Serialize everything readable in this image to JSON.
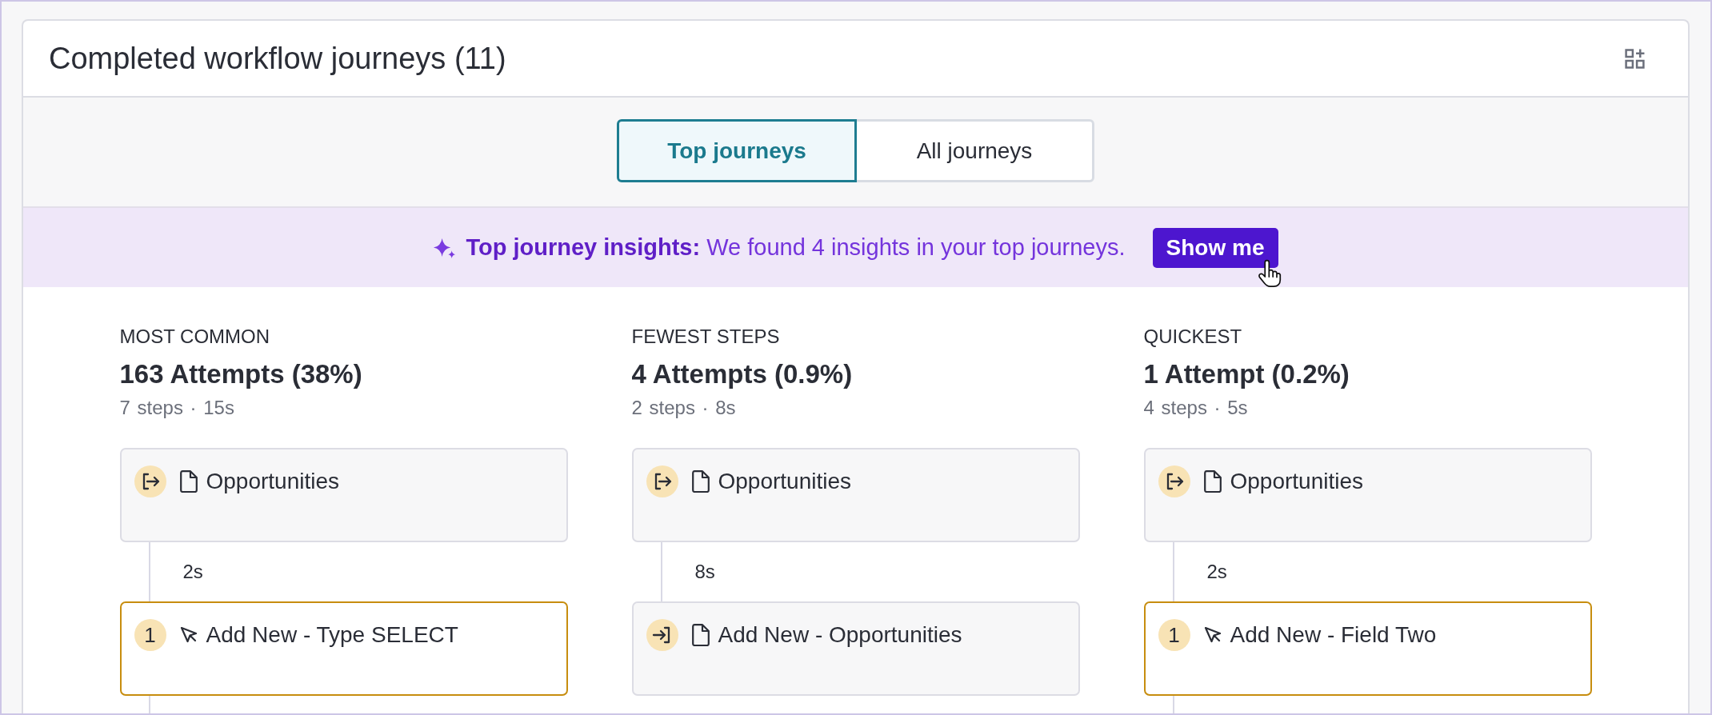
{
  "header": {
    "title": "Completed workflow journeys (11)"
  },
  "tabs": [
    {
      "label": "Top journeys",
      "selected": true
    },
    {
      "label": "All journeys",
      "selected": false
    }
  ],
  "insights_banner": {
    "text": "**Top journey insights:** We found 4 insights in your top journeys.",
    "button": "Show me"
  },
  "journeys": [
    {
      "category": "MOST COMMON",
      "attempts": "163 Attempts (38%)",
      "meta": "7 steps · 15s",
      "continues": true,
      "steps": [
        {
          "kind": "exit",
          "label": "Opportunities",
          "highlighted": false
        },
        {
          "time_before": "2s",
          "kind": "click",
          "number": "1",
          "label": "Add New - Type SELECT",
          "highlighted": true
        }
      ]
    },
    {
      "category": "FEWEST STEPS",
      "attempts": "4 Attempts (0.9%)",
      "meta": "2 steps · 8s",
      "continues": false,
      "steps": [
        {
          "kind": "exit",
          "label": "Opportunities",
          "highlighted": false
        },
        {
          "time_before": "8s",
          "kind": "enter",
          "label": "Add New - Opportunities",
          "highlighted": false
        }
      ]
    },
    {
      "category": "QUICKEST",
      "attempts": "1 Attempt (0.2%)",
      "meta": "4 steps · 5s",
      "continues": true,
      "steps": [
        {
          "kind": "exit",
          "label": "Opportunities",
          "highlighted": false
        },
        {
          "time_before": "2s",
          "kind": "click",
          "number": "1",
          "label": "Add New - Field Two",
          "highlighted": true
        }
      ]
    }
  ]
}
